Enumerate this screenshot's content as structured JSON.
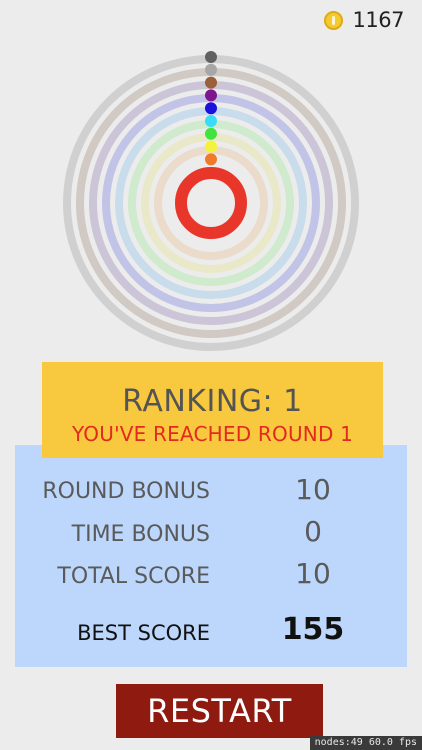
{
  "header": {
    "coin_icon": "coin-icon",
    "coin_count": "1167"
  },
  "target": {
    "ring_colors": [
      "#d0d0d0",
      "#d0c9c4",
      "#ccc5d8",
      "#c1c4e6",
      "#c8dcec",
      "#cfeacc",
      "#e9e9c9",
      "#eadbca"
    ],
    "dot_colors": [
      "#616161",
      "#a7a7a7",
      "#9a5f3b",
      "#7e1690",
      "#1a11dd",
      "#39dcf4",
      "#43e33d",
      "#f4f23a",
      "#ee7b2c"
    ],
    "center_ring_color": "#e8372a"
  },
  "ranking": {
    "title": "RANKING: 1",
    "subtitle": "YOU'VE REACHED ROUND 1",
    "color_panel": "#f8c93f",
    "color_subtitle": "#e4291f"
  },
  "scores": {
    "color_panel": "#bcd7fb",
    "round_bonus": {
      "label": "ROUND BONUS",
      "value": "10"
    },
    "time_bonus": {
      "label": "TIME BONUS",
      "value": "0"
    },
    "total_score": {
      "label": "TOTAL SCORE",
      "value": "10"
    },
    "best_score": {
      "label": "BEST SCORE",
      "value": "155"
    }
  },
  "restart": {
    "label": "RESTART",
    "color": "#8f1a10"
  },
  "debug": {
    "stats": "nodes:49  60.0 fps"
  }
}
